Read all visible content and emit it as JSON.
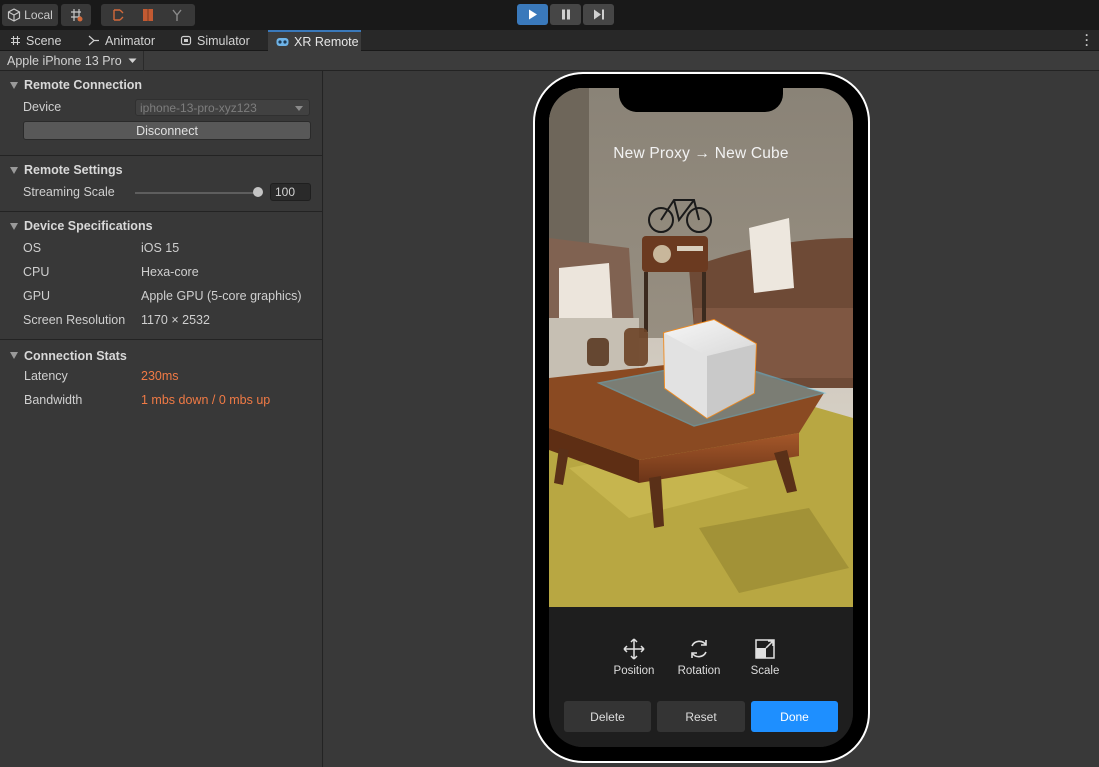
{
  "toolbar": {
    "local_label": "Local"
  },
  "tabs": [
    {
      "label": "Scene"
    },
    {
      "label": "Animator"
    },
    {
      "label": "Simulator"
    },
    {
      "label": "XR Remote"
    }
  ],
  "device_selector": {
    "value": "Apple iPhone 13 Pro"
  },
  "inspector": {
    "remote_connection": {
      "title": "Remote Connection",
      "device_label": "Device",
      "device_value": "iphone-13-pro-xyz123",
      "disconnect_label": "Disconnect"
    },
    "remote_settings": {
      "title": "Remote Settings",
      "streaming_scale_label": "Streaming Scale",
      "streaming_scale_value": "100"
    },
    "device_specs": {
      "title": "Device Specifications",
      "rows": [
        {
          "label": "OS",
          "value": "iOS 15"
        },
        {
          "label": "CPU",
          "value": "Hexa-core"
        },
        {
          "label": "GPU",
          "value": "Apple GPU (5-core graphics)"
        },
        {
          "label": "Screen Resolution",
          "value": "1170 × 2532"
        }
      ]
    },
    "connection_stats": {
      "title": "Connection Stats",
      "latency_label": "Latency",
      "latency_value": "230ms",
      "bandwidth_label": "Bandwidth",
      "bandwidth_value": "1 mbs down / 0 mbs up"
    }
  },
  "phone": {
    "proxy_label": "New Proxy → New Cube",
    "tools": [
      {
        "label": "Position",
        "icon": "move-arrows-icon"
      },
      {
        "label": "Rotation",
        "icon": "rotate-icon"
      },
      {
        "label": "Scale",
        "icon": "scale-icon"
      }
    ],
    "actions": {
      "delete": "Delete",
      "reset": "Reset",
      "done": "Done"
    }
  },
  "colors": {
    "accent": "#3a79bb",
    "warning_text": "#f07a45",
    "done_button": "#1e8fff",
    "selection_outline": "#f08a1e"
  }
}
